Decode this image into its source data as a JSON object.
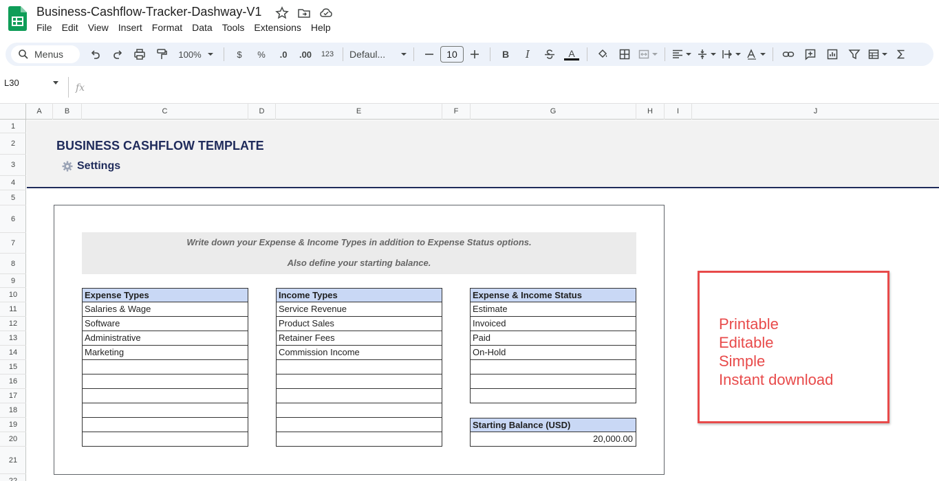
{
  "app": {
    "doc_title": "Business-Cashflow-Tracker-Dashway-V1",
    "menu": [
      "File",
      "Edit",
      "View",
      "Insert",
      "Format",
      "Data",
      "Tools",
      "Extensions",
      "Help"
    ]
  },
  "toolbar": {
    "search_label": "Menus",
    "zoom": "100%",
    "currency": "$",
    "percent": "%",
    "dec_less": ".0",
    "dec_more": ".00",
    "number_format": "123",
    "font": "Defaul...",
    "font_size": "10",
    "bold": "B",
    "italic": "I",
    "text_color_label": "A"
  },
  "formula_bar": {
    "cell_ref": "L30",
    "fx_label": "fx"
  },
  "columns": [
    "A",
    "B",
    "C",
    "D",
    "E",
    "F",
    "G",
    "H",
    "I",
    "J"
  ],
  "rows": [
    "1",
    "2",
    "3",
    "4",
    "5",
    "6",
    "7",
    "8",
    "9",
    "10",
    "11",
    "12",
    "13",
    "14",
    "15",
    "16",
    "17",
    "18",
    "19",
    "20",
    "21",
    "22"
  ],
  "sheet": {
    "title": "BUSINESS CASHFLOW TEMPLATE",
    "subtitle": "Settings",
    "note_line1": "Write down your Expense & Income Types in addition to Expense Status options.",
    "note_line2": "Also define your starting balance.",
    "expense_types": {
      "header": "Expense Types",
      "items": [
        "Salaries & Wage",
        "Software",
        "Administrative",
        "Marketing",
        "",
        "",
        "",
        "",
        "",
        ""
      ]
    },
    "income_types": {
      "header": "Income Types",
      "items": [
        "Service Revenue",
        "Product Sales",
        "Retainer Fees",
        "Commission Income",
        "",
        "",
        "",
        "",
        "",
        ""
      ]
    },
    "status": {
      "header": "Expense & Income Status",
      "items": [
        "Estimate",
        "Invoiced",
        "Paid",
        "On-Hold",
        "",
        "",
        ""
      ]
    },
    "starting_balance": {
      "header": "Starting Balance (USD)",
      "value": "20,000.00"
    }
  },
  "promo": {
    "lines": [
      "Printable",
      "Editable",
      "Simple",
      "Instant download"
    ],
    "color": "#e84a4a"
  },
  "colors": {
    "header_fill": "#c9d8f5",
    "title_color": "#1f2b5b",
    "toolbar_bg": "#edf2fa"
  }
}
